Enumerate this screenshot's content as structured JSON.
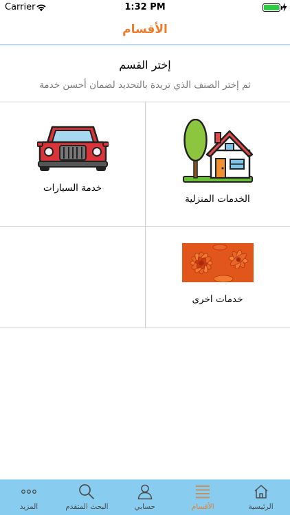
{
  "status_bar": {
    "carrier": "Carrier",
    "time": "1:32 PM",
    "battery_level": 1.0
  },
  "nav": {
    "title": "الأقسام"
  },
  "header": {
    "title": "إختر القسم",
    "subtitle": "ثم إختر الصنف الذي تريدة بالتحديد لضمان أحسن خدمة"
  },
  "categories": [
    {
      "label": "الخدمات المنزلية",
      "icon": "house-tree-icon"
    },
    {
      "label": "خدمة السيارات",
      "icon": "car-icon"
    },
    {
      "label": "خدمات اخرى",
      "icon": "orange-flower-photo"
    }
  ],
  "tab_bar": {
    "active_color": "#ee7d2b",
    "background": "#88ccf0",
    "tabs": [
      {
        "label": "الرئيسية",
        "icon": "home-icon",
        "active": false
      },
      {
        "label": "الأقسام",
        "icon": "menu-lines-icon",
        "active": true
      },
      {
        "label": "حسابي",
        "icon": "user-icon",
        "active": false
      },
      {
        "label": "البحث المتقدم",
        "icon": "search-icon",
        "active": false
      },
      {
        "label": "المزيد",
        "icon": "more-dots-icon",
        "active": false
      }
    ]
  },
  "colors": {
    "accent": "#ee7d2b",
    "nav_divider": "#b9dcef",
    "subtitle": "#7a7a7a"
  }
}
